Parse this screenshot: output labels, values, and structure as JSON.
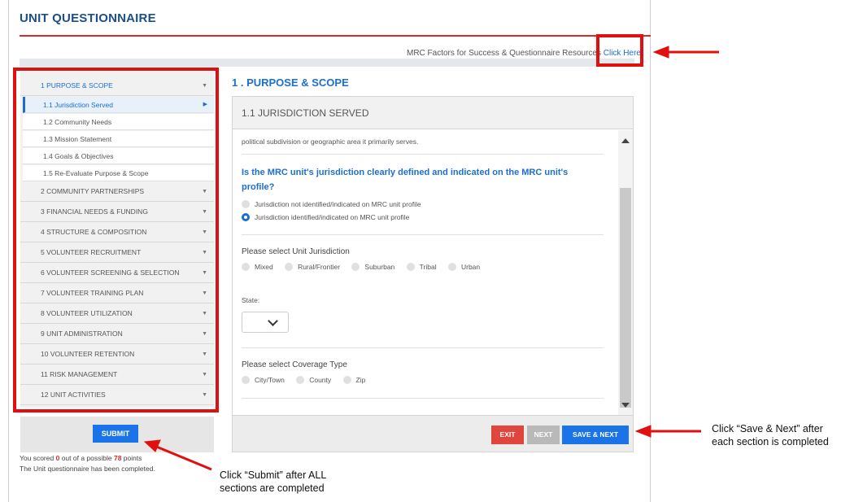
{
  "page": {
    "title": "UNIT QUESTIONNAIRE"
  },
  "resources": {
    "text": "MRC Factors for Success & Questionnaire Resources",
    "link": "Click Here"
  },
  "sidebar": {
    "section1": {
      "label": "1   PURPOSE & SCOPE",
      "subitems": [
        "1.1   Jurisdiction Served",
        "1.2   Community Needs",
        "1.3   Mission Statement",
        "1.4   Goals & Objectives",
        "1.5   Re-Evaluate Purpose & Scope"
      ]
    },
    "sections": [
      "2   COMMUNITY PARTNERSHIPS",
      "3   FINANCIAL NEEDS & FUNDING",
      "4   STRUCTURE & COMPOSITION",
      "5   VOLUNTEER RECRUITMENT",
      "6   VOLUNTEER SCREENING & SELECTION",
      "7   VOLUNTEER TRAINING PLAN",
      "8   VOLUNTEER UTILIZATION",
      "9   UNIT ADMINISTRATION",
      "10   VOLUNTEER RETENTION",
      "11   RISK MANAGEMENT",
      "12   UNIT ACTIVITIES"
    ]
  },
  "submit": {
    "label": "SUBMIT"
  },
  "score": {
    "prefix": "You scored ",
    "value": "0",
    "middle": " out of a possible ",
    "total": "78",
    "suffix": " points"
  },
  "completed_text": "The Unit questionnaire has been completed.",
  "main": {
    "section_title": "1 . PURPOSE & SCOPE",
    "panel_title": "1.1 JURISDICTION SERVED",
    "intro": "political subdivision or geographic area it primarily serves.",
    "question": "Is the MRC unit's jurisdiction clearly defined and indicated on the MRC unit's profile?",
    "options": [
      {
        "label": "Jurisdiction not identified/indicated on MRC unit profile",
        "selected": false
      },
      {
        "label": "Jurisdiction identified/indicated on MRC unit profile",
        "selected": true
      }
    ],
    "jurisdiction_label": "Please select Unit Jurisdiction",
    "jurisdiction_options": [
      "Mixed",
      "Rural/Frontier",
      "Suburban",
      "Tribal",
      "Urban"
    ],
    "state_label": "State:",
    "coverage_label": "Please select Coverage Type",
    "coverage_options": [
      "City/Town",
      "County",
      "Zip"
    ]
  },
  "footer": {
    "exit": "EXIT",
    "next": "NEXT",
    "save_next": "SAVE & NEXT"
  },
  "annotations": {
    "submit_note_1": "Click “Submit” after ALL",
    "submit_note_2": "sections are completed",
    "save_note_1": "Click “Save & Next” after",
    "save_note_2": "each section is completed"
  },
  "colors": {
    "accent": "#1a6fd1",
    "brand_title": "#1a4f8b",
    "annotation_red": "#e01010",
    "exit_red": "#e0463e"
  }
}
